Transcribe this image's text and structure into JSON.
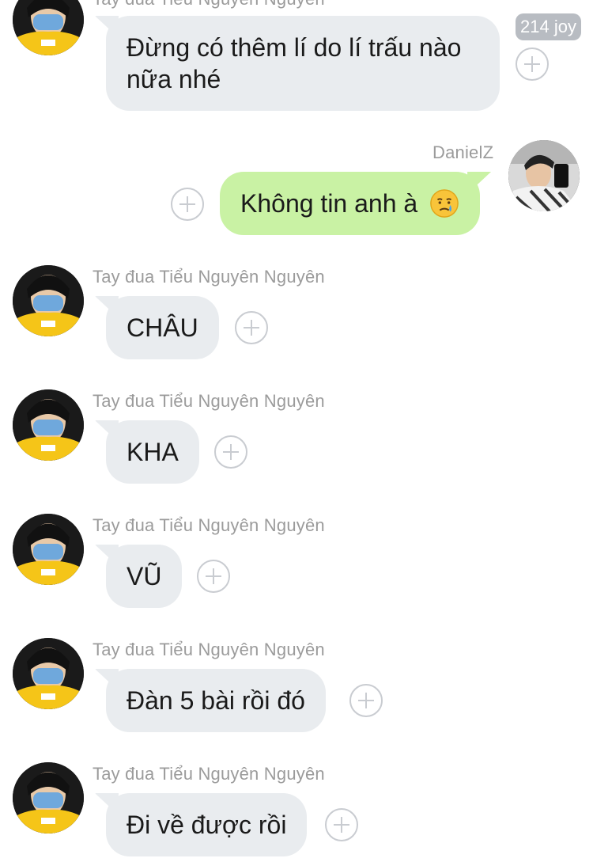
{
  "partial_sender": "Tay đua Tiểu Nguyên Nguyên",
  "first_message": "Đừng có thêm lí do lí trấu nào nữa nhé",
  "reaction_badge": "214 joy",
  "outgoing": {
    "sender": "DanielZ",
    "message": "Không tin anh à",
    "emoji": "crying-face-emoji"
  },
  "messages": [
    {
      "sender": "Tay đua Tiểu Nguyên Nguyên",
      "text": "CHÂU"
    },
    {
      "sender": "Tay đua Tiểu Nguyên Nguyên",
      "text": "KHA"
    },
    {
      "sender": "Tay đua Tiểu Nguyên Nguyên",
      "text": "VŨ"
    },
    {
      "sender": "Tay đua Tiểu Nguyên Nguyên",
      "text": "Đàn 5 bài rồi đó"
    },
    {
      "sender": "Tay đua Tiểu Nguyên Nguyên",
      "text": "Đi về được rồi"
    }
  ],
  "colors": {
    "incoming_bubble": "#e9ecef",
    "outgoing_bubble": "#c9f2a4",
    "sender_text": "#9b9b9b",
    "avatar_shirt": "#f5c518"
  }
}
